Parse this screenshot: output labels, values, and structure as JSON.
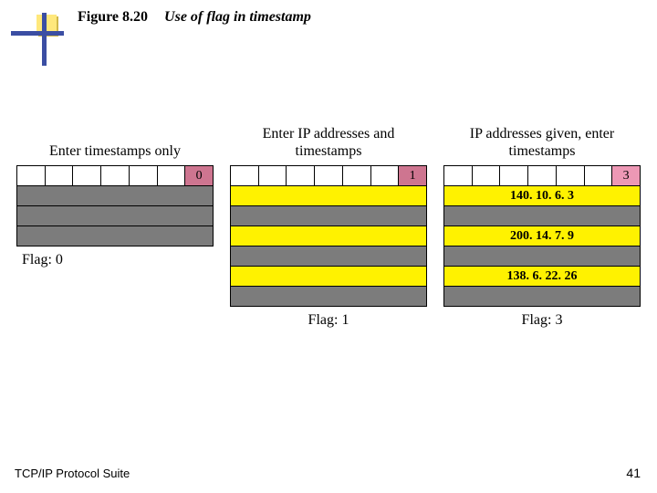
{
  "header": {
    "figure_number": "Figure 8.20",
    "figure_title": "Use of flag in timestamp"
  },
  "columns": [
    {
      "heading": "Enter timestamps only",
      "flag_value": "0",
      "rows": [
        {
          "type": "grey"
        },
        {
          "type": "grey"
        },
        {
          "type": "grey"
        }
      ],
      "caption": "Flag: 0"
    },
    {
      "heading": "Enter IP addresses and timestamps",
      "flag_value": "1",
      "rows": [
        {
          "type": "pair",
          "ip": "",
          "ts": ""
        },
        {
          "type": "pair",
          "ip": "",
          "ts": ""
        },
        {
          "type": "pair",
          "ip": "",
          "ts": ""
        }
      ],
      "caption": "Flag: 1"
    },
    {
      "heading": "IP addresses given, enter timestamps",
      "flag_value": "3",
      "rows": [
        {
          "type": "pair",
          "ip": "140. 10. 6. 3",
          "ts": ""
        },
        {
          "type": "pair",
          "ip": "200. 14. 7. 9",
          "ts": ""
        },
        {
          "type": "pair",
          "ip": "138. 6. 22. 26",
          "ts": ""
        }
      ],
      "caption": "Flag: 3"
    }
  ],
  "footer": {
    "left": "TCP/IP Protocol Suite",
    "page": "41"
  },
  "chart_data": {
    "type": "table",
    "title": "Use of flag in timestamp",
    "series": [
      {
        "name": "Flag 0 — timestamps only",
        "flag": 0,
        "entries": 3,
        "fields": [
          "timestamp"
        ]
      },
      {
        "name": "Flag 1 — IP + timestamp (empty)",
        "flag": 1,
        "entries": 3,
        "fields": [
          "ip",
          "timestamp"
        ]
      },
      {
        "name": "Flag 3 — IP given, timestamp entered",
        "flag": 3,
        "entries": 3,
        "fields": [
          "ip",
          "timestamp"
        ],
        "given_ips": [
          "140.10.6.3",
          "200.14.7.9",
          "138.6.22.26"
        ]
      }
    ]
  }
}
